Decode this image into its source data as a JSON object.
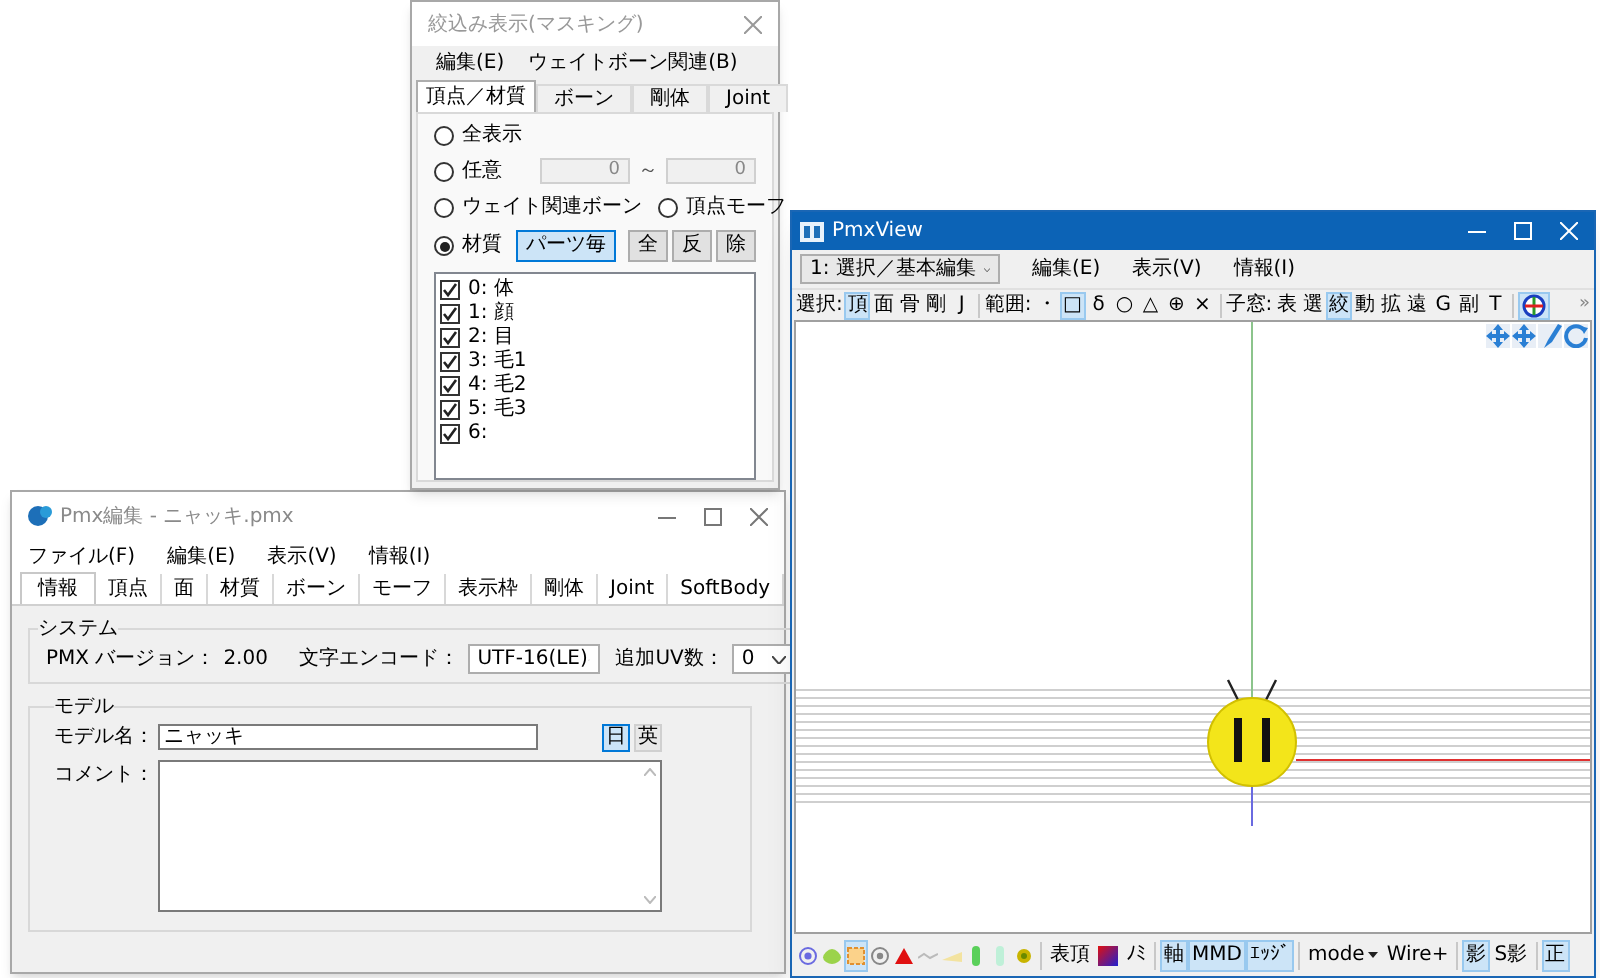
{
  "mask_window": {
    "title": "絞込み表示(マスキング)",
    "menu": [
      "編集(E)",
      "ウェイトボーン関連(B)"
    ],
    "tabs": [
      {
        "label": "頂点／材質",
        "selected": true
      },
      {
        "label": "ボーン",
        "selected": false
      },
      {
        "label": "剛体",
        "selected": false
      },
      {
        "label": "Joint",
        "selected": false
      }
    ],
    "modes": [
      {
        "label": "全表示",
        "selected": false
      },
      {
        "label": "任意",
        "selected": false
      },
      {
        "label": "ウェイト関連ボーン",
        "selected": false
      },
      {
        "label": "頂点モーフ",
        "selected": false
      },
      {
        "label": "材質",
        "selected": true
      }
    ],
    "range_from": "0",
    "range_sep": "～",
    "range_to": "0",
    "material_buttons": [
      {
        "label": "パーツ毎",
        "selected": true
      },
      {
        "label": "全",
        "selected": false
      },
      {
        "label": "反",
        "selected": false
      },
      {
        "label": "除",
        "selected": false
      }
    ],
    "materials": [
      {
        "label": "0: 体",
        "checked": true
      },
      {
        "label": "1: 顔",
        "checked": true
      },
      {
        "label": "2: 目",
        "checked": true
      },
      {
        "label": "3: 毛1",
        "checked": true
      },
      {
        "label": "4: 毛2",
        "checked": true
      },
      {
        "label": "5: 毛3",
        "checked": true
      },
      {
        "label": "6:",
        "checked": true
      }
    ]
  },
  "editor_window": {
    "title": "Pmx編集 - ニャッキ.pmx",
    "menu": [
      "ファイル(F)",
      "編集(E)",
      "表示(V)",
      "情報(I)"
    ],
    "tabs": [
      {
        "label": "情報",
        "selected": true
      },
      {
        "label": "頂点",
        "selected": false
      },
      {
        "label": "面",
        "selected": false
      },
      {
        "label": "材質",
        "selected": false
      },
      {
        "label": "ボーン",
        "selected": false
      },
      {
        "label": "モーフ",
        "selected": false
      },
      {
        "label": "表示枠",
        "selected": false
      },
      {
        "label": "剛体",
        "selected": false
      },
      {
        "label": "Joint",
        "selected": false
      },
      {
        "label": "SoftBody",
        "selected": false
      }
    ],
    "system": {
      "title": "システム",
      "version_label": "PMX バージョン：",
      "version": "2.00",
      "encoding_label": "文字エンコード：",
      "encoding": "UTF-16(LE)",
      "uv_label": "追加UV数：",
      "uv": "0"
    },
    "model": {
      "title": "モデル",
      "name_label": "モデル名：",
      "name": "ニャッキ",
      "languages": [
        {
          "label": "日",
          "selected": true
        },
        {
          "label": "英",
          "selected": false
        }
      ],
      "comment_label": "コメント："
    }
  },
  "view_window": {
    "title": "PmxView",
    "mode_select": "1: 選択／基本編集",
    "menu": [
      "編集(E)",
      "表示(V)",
      "情報(I)"
    ],
    "toolbar_groups": [
      {
        "label": "選択:",
        "buttons": [
          {
            "label": "頂",
            "selected": true
          },
          {
            "label": "面",
            "selected": false
          },
          {
            "label": "骨",
            "selected": false
          },
          {
            "label": "剛",
            "selected": false
          },
          {
            "label": "J",
            "selected": false
          }
        ]
      },
      {
        "label": "範囲:",
        "buttons": [
          {
            "label": "・",
            "selected": false
          },
          {
            "label": "□",
            "selected": true
          },
          {
            "label": "δ",
            "selected": false
          },
          {
            "label": "○",
            "selected": false
          },
          {
            "label": "△",
            "selected": false
          },
          {
            "label": "⊕",
            "selected": false
          },
          {
            "label": "×",
            "selected": false
          }
        ]
      },
      {
        "label": "子窓:",
        "buttons": [
          {
            "label": "表",
            "selected": false
          },
          {
            "label": "選",
            "selected": false
          },
          {
            "label": "絞",
            "selected": true
          },
          {
            "label": "動",
            "selected": false
          },
          {
            "label": "拡",
            "selected": false
          },
          {
            "label": "遠",
            "selected": false
          },
          {
            "label": "G",
            "selected": false
          },
          {
            "label": "副",
            "selected": false
          },
          {
            "label": "T",
            "selected": false
          }
        ]
      }
    ],
    "globe_button": {
      "selected": true
    },
    "overflow": "»",
    "bottom_items": [
      {
        "kind": "target",
        "selected": false
      },
      {
        "kind": "blob",
        "selected": false
      },
      {
        "kind": "box",
        "selected": true
      },
      {
        "kind": "point",
        "selected": false
      },
      {
        "kind": "triangle",
        "selected": false
      },
      {
        "kind": "line",
        "selected": false
      },
      {
        "kind": "wedge",
        "selected": false
      },
      {
        "kind": "capsule",
        "selected": false
      },
      {
        "kind": "pill",
        "selected": false
      },
      {
        "kind": "flower",
        "selected": false
      },
      {
        "kind": "separator"
      },
      {
        "kind": "text",
        "label": "表頂",
        "selected": false
      },
      {
        "kind": "swatch",
        "selected": false
      },
      {
        "kind": "text",
        "label": "ﾉﾐ",
        "selected": false
      },
      {
        "kind": "separator"
      },
      {
        "kind": "text",
        "label": "軸",
        "selected": true
      },
      {
        "kind": "text",
        "label": "MMD",
        "selected": true
      },
      {
        "kind": "text",
        "label": "ｴｯｼﾞ",
        "selected": true
      },
      {
        "kind": "separator"
      },
      {
        "kind": "dropdown",
        "label": "mode",
        "selected": false
      },
      {
        "kind": "text",
        "label": "Wire+",
        "selected": false
      },
      {
        "kind": "separator"
      },
      {
        "kind": "text",
        "label": "影",
        "selected": true
      },
      {
        "kind": "text",
        "label": "S影",
        "selected": false
      },
      {
        "kind": "separator"
      },
      {
        "kind": "text",
        "label": "正",
        "selected": true
      }
    ]
  }
}
